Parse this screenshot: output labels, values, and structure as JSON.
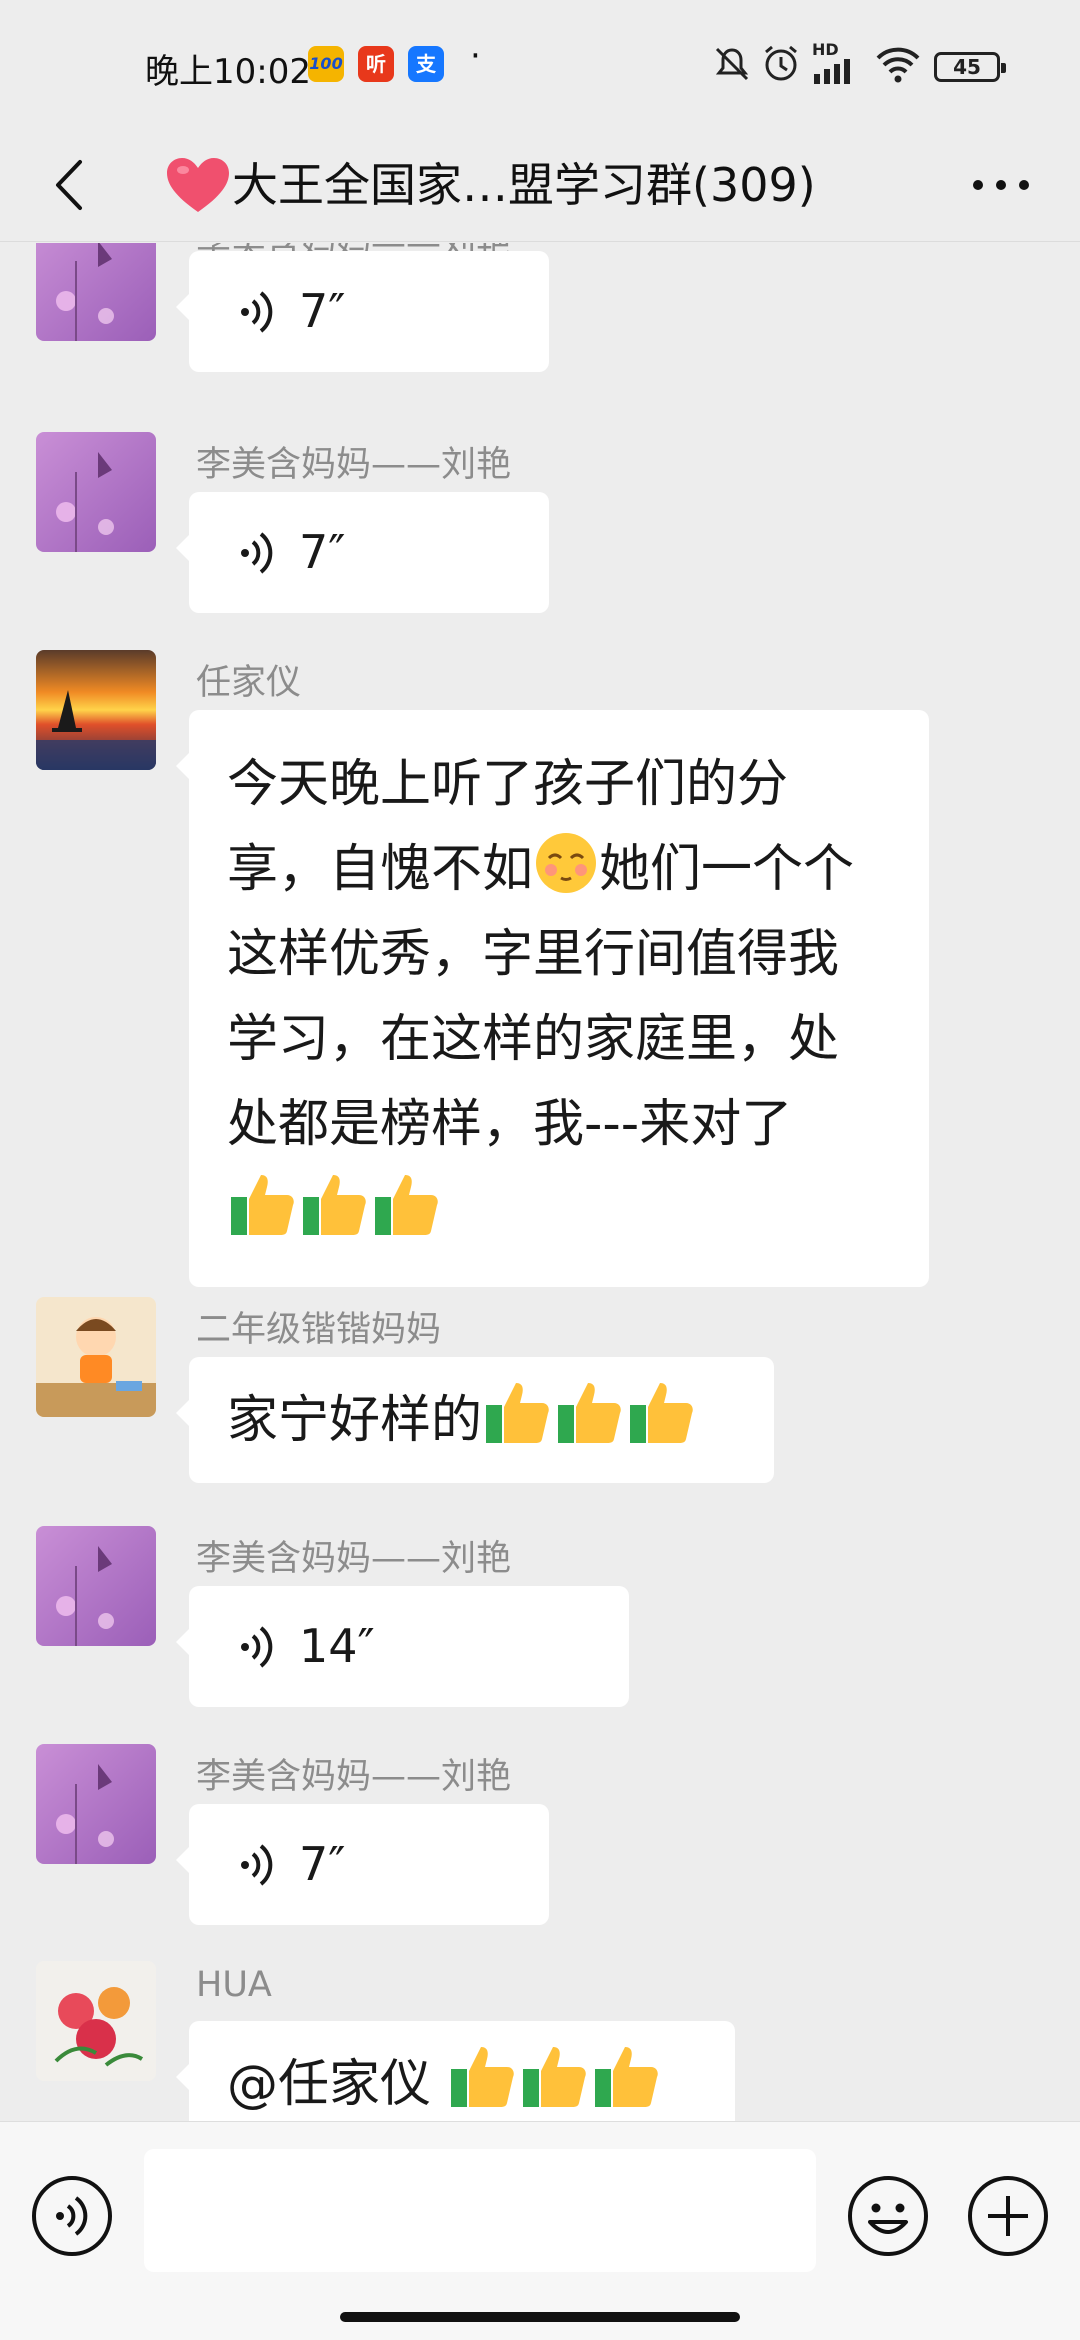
{
  "status_bar": {
    "time": "晚上10:02",
    "apps": [
      "100",
      "听",
      "支"
    ],
    "dot": "·",
    "network_label": "HD",
    "battery": "45"
  },
  "header": {
    "title": "大王全国家…盟学习群(309)"
  },
  "messages": [
    {
      "sender": "李美含妈妈——刘艳",
      "type": "voice",
      "duration": "7″"
    },
    {
      "sender": "李美含妈妈——刘艳",
      "type": "voice",
      "duration": "7″"
    },
    {
      "sender": "任家仪",
      "type": "text",
      "lines": [
        "今天晚上听了孩子们的分",
        "享，自愧不如",
        "她们一个个",
        "这样优秀，字里行间值得我",
        "学习，在这样的家庭里，处",
        "处都是榜样，我---来对了"
      ]
    },
    {
      "sender": "二年级锴锴妈妈",
      "type": "text",
      "text": "家宁好样的"
    },
    {
      "sender": "李美含妈妈——刘艳",
      "type": "voice",
      "duration": "14″"
    },
    {
      "sender": "李美含妈妈——刘艳",
      "type": "voice",
      "duration": "7″"
    },
    {
      "sender": "HUA",
      "type": "text",
      "text": "@任家仪 "
    }
  ],
  "colors": {
    "background": "#ededed",
    "bubble": "#ffffff",
    "sender_name": "#8c8c8c",
    "heart": "#f0506e"
  }
}
